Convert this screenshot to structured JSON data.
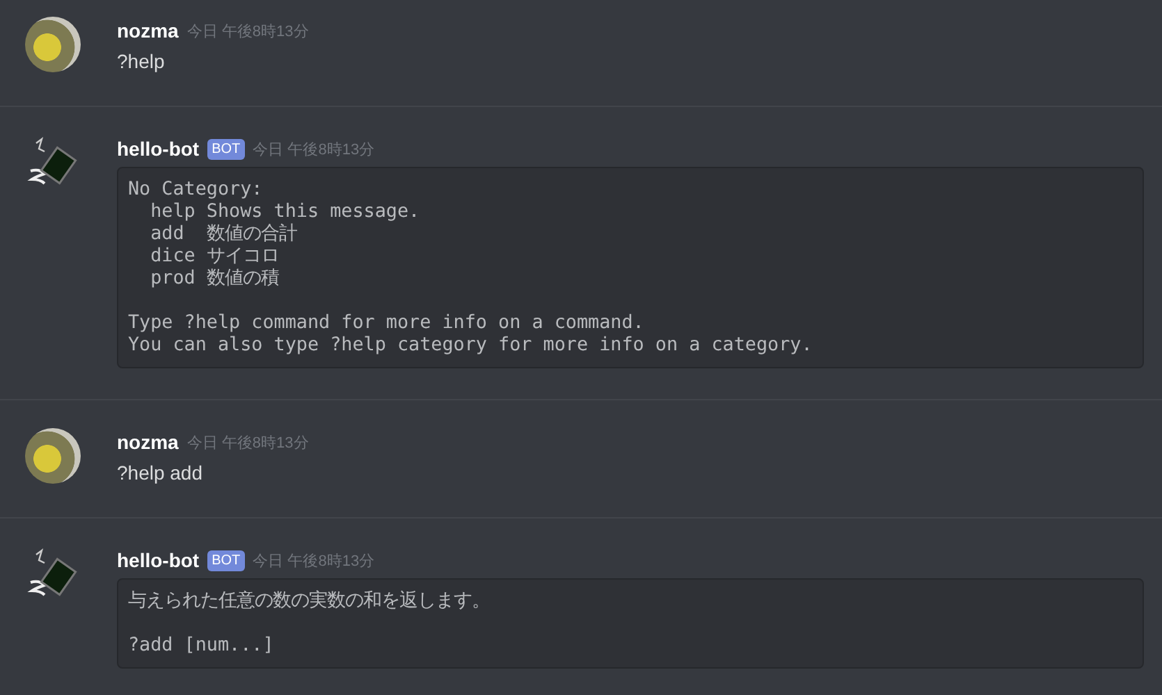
{
  "messages": [
    {
      "kind": "user",
      "author": "nozma",
      "timestamp": "今日 午後8時13分",
      "body": {
        "kind": "text",
        "text": "?help"
      }
    },
    {
      "kind": "bot",
      "author": "hello-bot",
      "badge": "BOT",
      "timestamp": "今日 午後8時13分",
      "body": {
        "kind": "code",
        "text": "No Category:\n  help Shows this message.\n  add  数値の合計\n  dice サイコロ\n  prod 数値の積\n\nType ?help command for more info on a command.\nYou can also type ?help category for more info on a category."
      }
    },
    {
      "kind": "user",
      "author": "nozma",
      "timestamp": "今日 午後8時13分",
      "body": {
        "kind": "text",
        "text": "?help add"
      }
    },
    {
      "kind": "bot",
      "author": "hello-bot",
      "badge": "BOT",
      "timestamp": "今日 午後8時13分",
      "body": {
        "kind": "code",
        "text": "与えられた任意の数の実数の和を返します。\n\n?add [num...]"
      }
    }
  ]
}
